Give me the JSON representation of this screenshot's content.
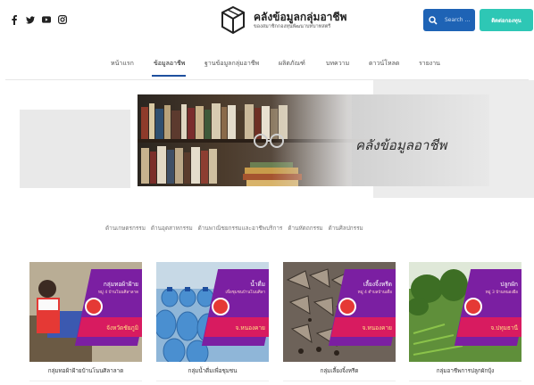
{
  "header": {
    "social": [
      "facebook-icon",
      "twitter-icon",
      "youtube-icon",
      "instagram-icon"
    ],
    "logo_title": "คลังข้อมูลกลุ่มอาชีพ",
    "logo_subtitle": "ของสมาชิกกองทุนพัฒนาบทบาทสตรี",
    "search_placeholder": "Search ...",
    "contact_label": "ติดต่อกองทุน"
  },
  "nav": {
    "items": [
      "หน้าแรก",
      "ข้อมูลอาชีพ",
      "ฐานข้อมูลกลุ่มอาชีพ",
      "ผลิตภัณฑ์",
      "บทความ",
      "ดาวน์โหลด",
      "รายงาน"
    ],
    "active_index": 1
  },
  "banner": {
    "title": "คลังข้อมูลอาชีพ"
  },
  "categories": [
    "ด้านเกษตรกรรม",
    "ด้านอุตสาหกรรม",
    "ด้านพาณิชยกรรมและอาชีพบริการ",
    "ด้านหัตถกรรม",
    "ด้านศิลปกรรม"
  ],
  "cards": [
    {
      "caption": "กลุ่มทอผ้าฝ้ายบ้านโนนศิลาลาด",
      "ribbon_title": "กลุ่มทอผ้าฝ้าย",
      "ribbon_sub": "หมู่ 4 บ้านโนนศิลาลาด",
      "ribbon_place": "จังหวัดชัยภูมิ"
    },
    {
      "caption": "กลุ่มน้ำดื่มเพื่อชุมชน",
      "ribbon_title": "น้ำดื่ม",
      "ribbon_sub": "เพื่อชุมชนบ้านโนนศิลา",
      "ribbon_place": "จ.หนองคาย"
    },
    {
      "caption": "กลุ่มเลี้ยงจิ้งหรีด",
      "ribbon_title": "เลี้ยงจิ้งหรีด",
      "ribbon_sub": "หมู่ 4 ตำบลบ้านเดื่อ",
      "ribbon_place": "จ.หนองคาย"
    },
    {
      "caption": "กลุ่มอาชีพการปลูกผักบุ้ง",
      "ribbon_title": "ปลูกผัก",
      "ribbon_sub": "หมู่ 3 บ้านหนองผือ",
      "ribbon_place": "จ.ปทุมธานี"
    }
  ]
}
